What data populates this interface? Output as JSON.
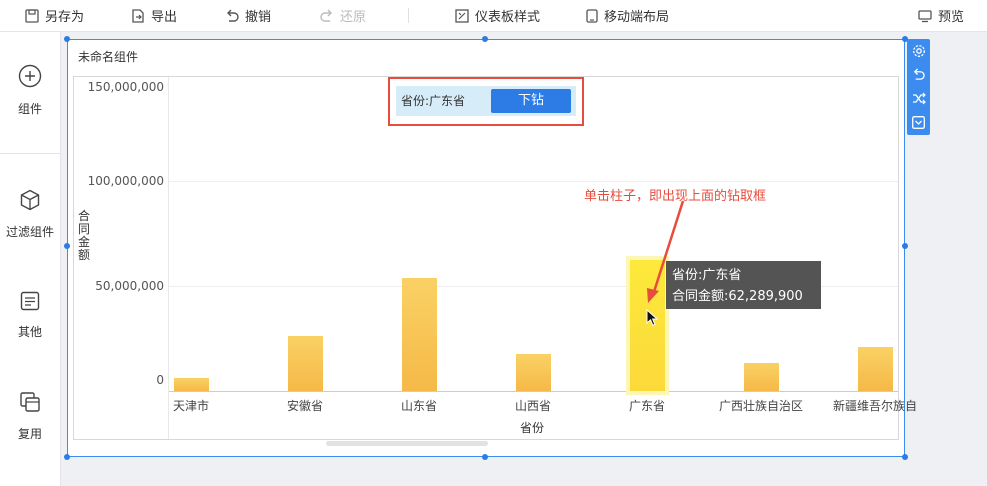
{
  "toolbar": {
    "save_as": "另存为",
    "export": "导出",
    "undo": "撤销",
    "redo": "还原",
    "dashboard_style": "仪表板样式",
    "mobile_layout": "移动端布局",
    "preview": "预览"
  },
  "sidebar": {
    "items": [
      {
        "label": "组件",
        "icon": "plus-circle-icon"
      },
      {
        "label": "过滤组件",
        "icon": "cube-icon"
      },
      {
        "label": "其他",
        "icon": "document-icon"
      },
      {
        "label": "复用",
        "icon": "copy-icon"
      }
    ]
  },
  "widget": {
    "title": "未命名组件",
    "drill": {
      "label": "省份:广东省",
      "button": "下钻"
    },
    "tooltip": {
      "line1": "省份:广东省",
      "line2": "合同金额:62,289,900"
    },
    "annotation": "单击柱子，即出现上面的钻取框"
  },
  "colors": {
    "accent": "#2d7be5",
    "bar": "#f5b947",
    "bar_active": "#fde93b",
    "annotation": "#e74c3c"
  },
  "chart_data": {
    "type": "bar",
    "categories": [
      "天津市",
      "安徽省",
      "山东省",
      "山西省",
      "广东省",
      "广西壮族自治区",
      "新疆维吾尔族自"
    ],
    "values": [
      6000000,
      26000000,
      54000000,
      17500000,
      62289900,
      13500000,
      21000000
    ],
    "xlabel": "省份",
    "ylabel": "合同金额",
    "ylim": [
      0,
      150000000
    ],
    "yticks": [
      "150,000,000",
      "100,000,000",
      "50,000,000",
      "0"
    ],
    "active_index": 4,
    "grid": true
  }
}
